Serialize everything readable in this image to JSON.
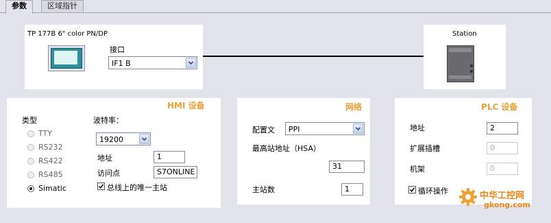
{
  "tabs": [
    {
      "label": "参数",
      "active": true
    },
    {
      "label": "区域指针",
      "active": false
    }
  ],
  "device": {
    "name": "TP 177B 6\" color PN/DP",
    "interface_label": "接口",
    "interface_value": "IF1 B"
  },
  "station": {
    "label": "Station"
  },
  "hmi": {
    "title": "HMI 设备",
    "type_label": "类型",
    "types": [
      "TTY",
      "RS232",
      "RS422",
      "RS485",
      "Simatic"
    ],
    "selected_type": "Simatic",
    "baud_label": "波特率：",
    "baud_value": "19200",
    "address_label": "地址",
    "address_value": "1",
    "access_point_label": "访问点",
    "access_point_value": "S7ONLINE",
    "only_master_label": "总线上的唯一主站",
    "only_master_checked": true
  },
  "network": {
    "title": "网络",
    "profile_label": "配置文",
    "profile_value": "PPI",
    "hsa_label": "最高站地址（HSA）",
    "hsa_value": "31",
    "masters_label": "主站数",
    "masters_value": "1"
  },
  "plc": {
    "title": "PLC 设备",
    "address_label": "地址",
    "address_value": "2",
    "ext_slot_label": "扩展插槽",
    "ext_slot_value": "0",
    "rack_label": "机架",
    "rack_value": "0",
    "cyclic_label": "循环操作",
    "cyclic_checked": true
  },
  "watermark": {
    "text": "中华工控网",
    "url": "gkong.com"
  },
  "colors": {
    "section_title": "#e8a23a",
    "background": "#e3e3eb",
    "panel": "#ffffff",
    "watermark": "#e8881a"
  }
}
